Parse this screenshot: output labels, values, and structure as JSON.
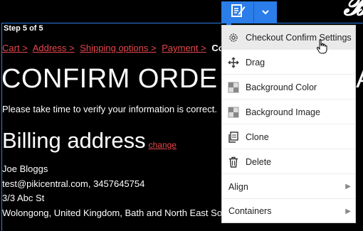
{
  "page": {
    "step": "Step 5 of 5",
    "breadcrumb": [
      {
        "label": "Cart"
      },
      {
        "label": "Address"
      },
      {
        "label": "Shipping options"
      },
      {
        "label": "Payment"
      }
    ],
    "breadcrumb_sep": ">",
    "breadcrumb_current": "Co",
    "title": "CONFIRM ORDE",
    "title_tail": "A",
    "note": "Please take time to verify your information is correct.",
    "billing_heading": "Billing address",
    "change_link": "change",
    "address_lines": [
      "Joe Bloggs",
      "test@pikicentral.com, 3457645754",
      "3/3 Abc St",
      "Wolongong, United Kingdom, Bath and North East So"
    ]
  },
  "toolbar": {
    "main_icon": "edit-note-icon",
    "dropdown_icon": "chevron-down-icon"
  },
  "menu": {
    "items": [
      {
        "label": "Checkout Confirm Settings",
        "icon": "gear-icon"
      },
      {
        "label": "Drag",
        "icon": "move-icon"
      },
      {
        "label": "Background Color",
        "icon": "checker-icon"
      },
      {
        "label": "Background Image",
        "icon": "checker-icon"
      },
      {
        "label": "Clone",
        "icon": "clone-icon"
      },
      {
        "label": "Delete",
        "icon": "trash-icon"
      },
      {
        "label": "Align",
        "icon": "arrow-right-icon"
      },
      {
        "label": "Containers",
        "icon": "arrow-right-icon"
      }
    ]
  },
  "colors": {
    "accent": "#2b7de9",
    "link": "#e8474b",
    "background": "#000000"
  }
}
